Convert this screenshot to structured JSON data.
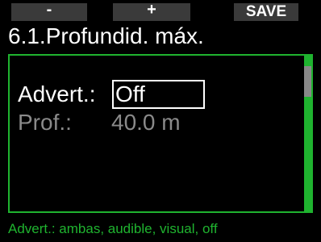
{
  "softkeys": {
    "left_label": "-",
    "middle_label": "+",
    "right_label": "SAVE"
  },
  "header": {
    "title": "6.1.Profundid. máx."
  },
  "settings": {
    "alarm_label": "Advert.:",
    "alarm_value": "Off",
    "depth_label": "Prof.:",
    "depth_value": "40.0 m"
  },
  "footer": {
    "help_text": "Advert.: ambas, audible, visual, off"
  },
  "colors": {
    "accent": "#1fb32f",
    "background": "#000000",
    "softkey_bg": "#3a3a3a",
    "disabled_text": "#8a8a8a"
  }
}
